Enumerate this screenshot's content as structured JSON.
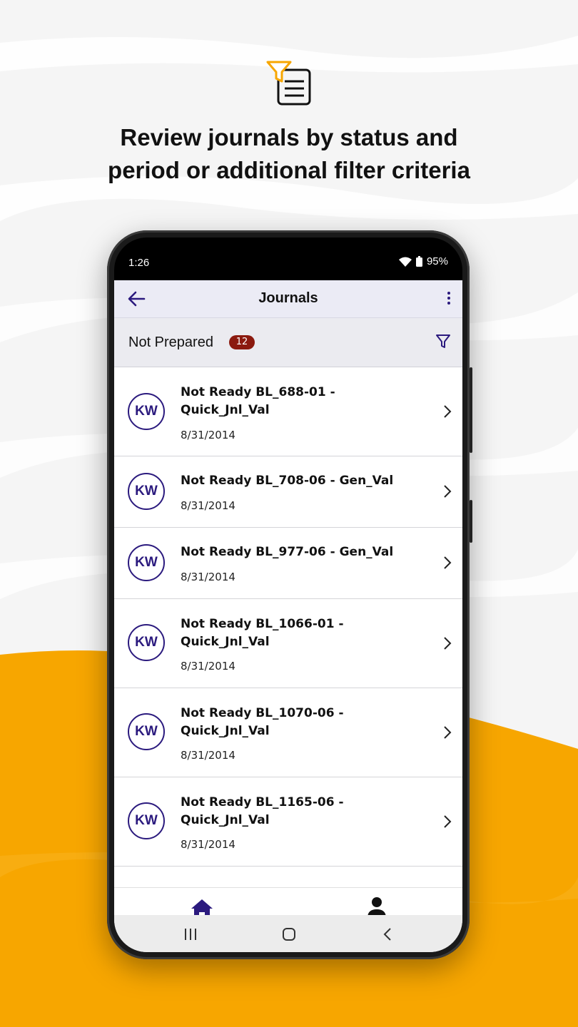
{
  "promo": {
    "headline_line1": "Review journals by status and",
    "headline_line2": "period or additional filter criteria",
    "icon": "filter-document-icon"
  },
  "colors": {
    "accent": "#2b1a7e",
    "badge": "#8b1a0f",
    "brand_yellow": "#f7a600",
    "header_bg": "#ebebf5"
  },
  "status_bar": {
    "time": "1:26",
    "battery": "95%"
  },
  "header": {
    "title": "Journals",
    "back_icon": "arrow-left-icon",
    "menu_icon": "more-vertical-icon"
  },
  "filter": {
    "label": "Not Prepared",
    "count": "12",
    "icon": "filter-icon"
  },
  "journals": [
    {
      "initials": "KW",
      "title": "Not Ready BL_688-01 - Quick_Jnl_Val",
      "date": "8/31/2014"
    },
    {
      "initials": "KW",
      "title": "Not Ready BL_708-06 - Gen_Val",
      "date": "8/31/2014"
    },
    {
      "initials": "KW",
      "title": "Not Ready BL_977-06 - Gen_Val",
      "date": "8/31/2014"
    },
    {
      "initials": "KW",
      "title": "Not Ready BL_1066-01 - Quick_Jnl_Val",
      "date": "8/31/2014"
    },
    {
      "initials": "KW",
      "title": "Not Ready BL_1070-06 - Quick_Jnl_Val",
      "date": "8/31/2014"
    },
    {
      "initials": "KW",
      "title": "Not Ready BL_1165-06 - Quick_Jnl_Val",
      "date": "8/31/2014"
    }
  ],
  "bottom_nav": {
    "items": [
      "home-icon",
      "profile-icon"
    ]
  },
  "system_nav": {
    "items": [
      "recent-apps-icon",
      "home-button-icon",
      "back-chevron-icon"
    ]
  }
}
